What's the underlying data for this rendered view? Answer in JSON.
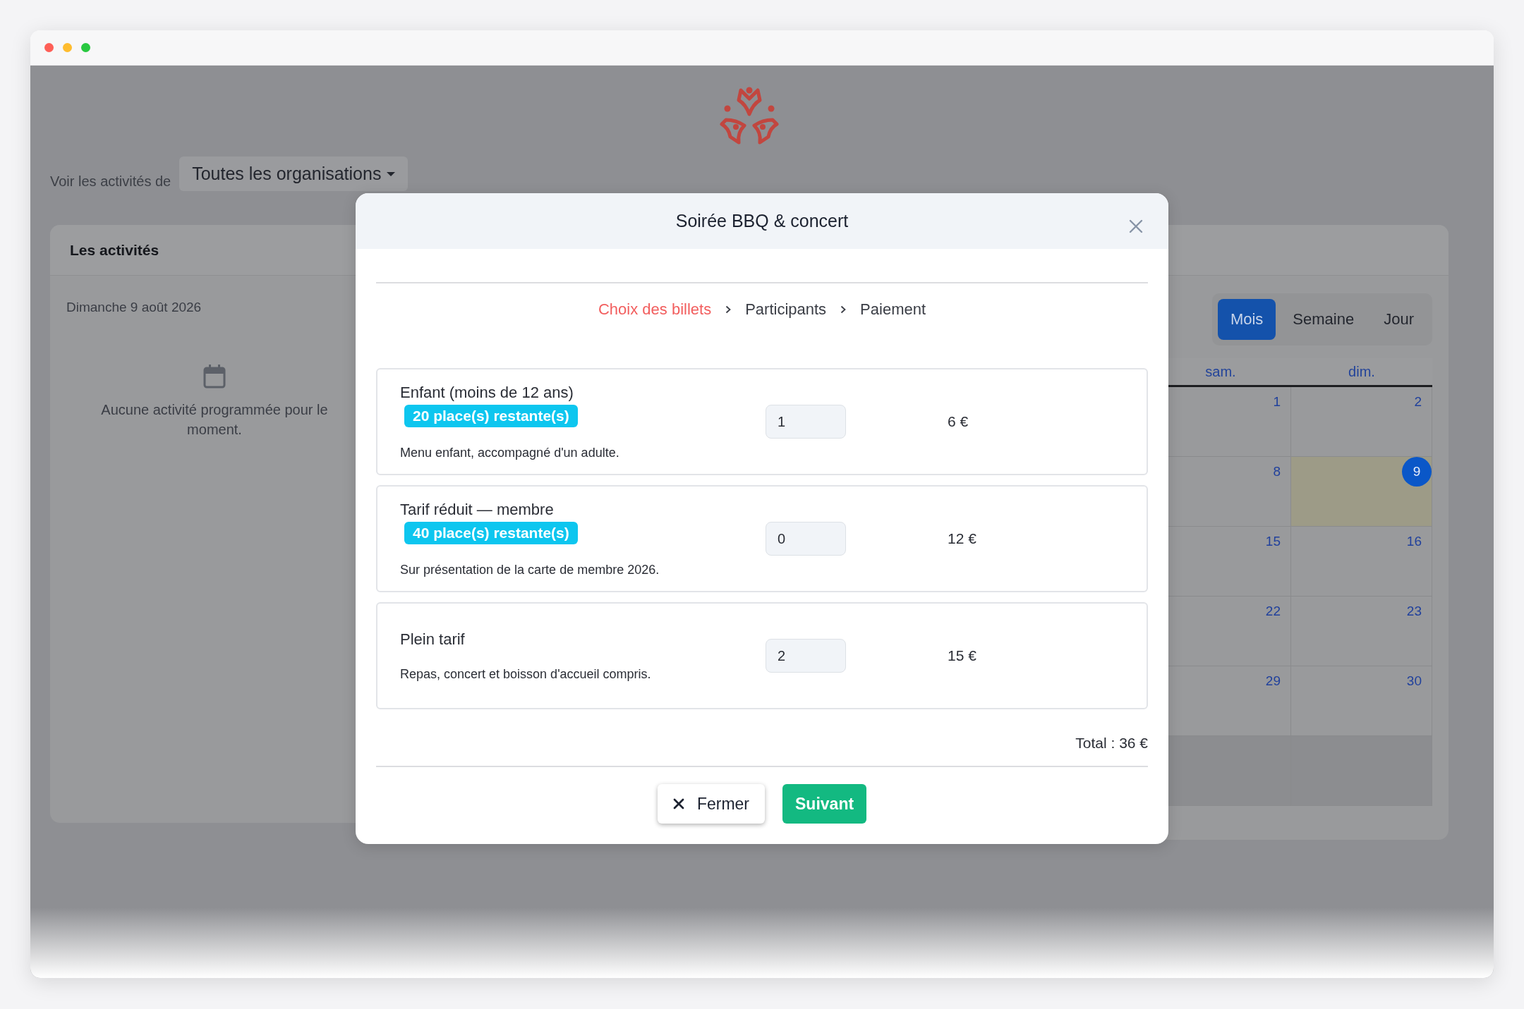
{
  "filter": {
    "label": "Voir les activités de",
    "dropdown": "Toutes les organisations"
  },
  "activities": {
    "title": "Les activités",
    "date": "Dimanche 9 août 2026",
    "empty_message": "Aucune activité programmée pour le moment."
  },
  "calendar": {
    "views": [
      {
        "label": "Mois",
        "selected": true
      },
      {
        "label": "Semaine",
        "selected": false
      },
      {
        "label": "Jour",
        "selected": false
      }
    ],
    "weekdays": [
      "sam.",
      "dim."
    ],
    "weeks": [
      {
        "days": [
          {
            "label": "1",
            "today": false
          },
          {
            "label": "2",
            "today": false
          }
        ]
      },
      {
        "days": [
          {
            "label": "8",
            "today": false
          },
          {
            "label": "9",
            "today": true
          }
        ]
      },
      {
        "days": [
          {
            "label": "15",
            "today": false
          },
          {
            "label": "16",
            "today": false
          }
        ]
      },
      {
        "days": [
          {
            "label": "22",
            "today": false
          },
          {
            "label": "23",
            "today": false
          }
        ]
      },
      {
        "days": [
          {
            "label": "29",
            "today": false
          },
          {
            "label": "30",
            "today": false
          }
        ]
      },
      {
        "outside_month": true
      }
    ]
  },
  "modal": {
    "title": "Soirée BBQ & concert",
    "steps": [
      {
        "label": "Choix des billets",
        "selected": true
      },
      {
        "label": "Participants",
        "selected": false
      },
      {
        "label": "Paiement",
        "selected": false
      }
    ],
    "tickets": [
      {
        "name": "Enfant (moins de 12 ans)",
        "badge": "20 place(s) restante(s)",
        "description": "Menu enfant, accompagné d'un adulte.",
        "quantity": "1",
        "price": "6 €"
      },
      {
        "name": "Tarif réduit — membre",
        "badge": "40 place(s) restante(s)",
        "description": "Sur présentation de la carte de membre 2026.",
        "quantity": "0",
        "price": "12 €"
      },
      {
        "name": "Plein tarif",
        "description": "Repas, concert et boisson d'accueil compris.",
        "quantity": "2",
        "price": "15 €"
      }
    ],
    "total": "Total : 36 €",
    "buttons": [
      {
        "kind": "close",
        "label": "Fermer"
      },
      {
        "kind": "primary",
        "label": "Suivant"
      }
    ]
  }
}
